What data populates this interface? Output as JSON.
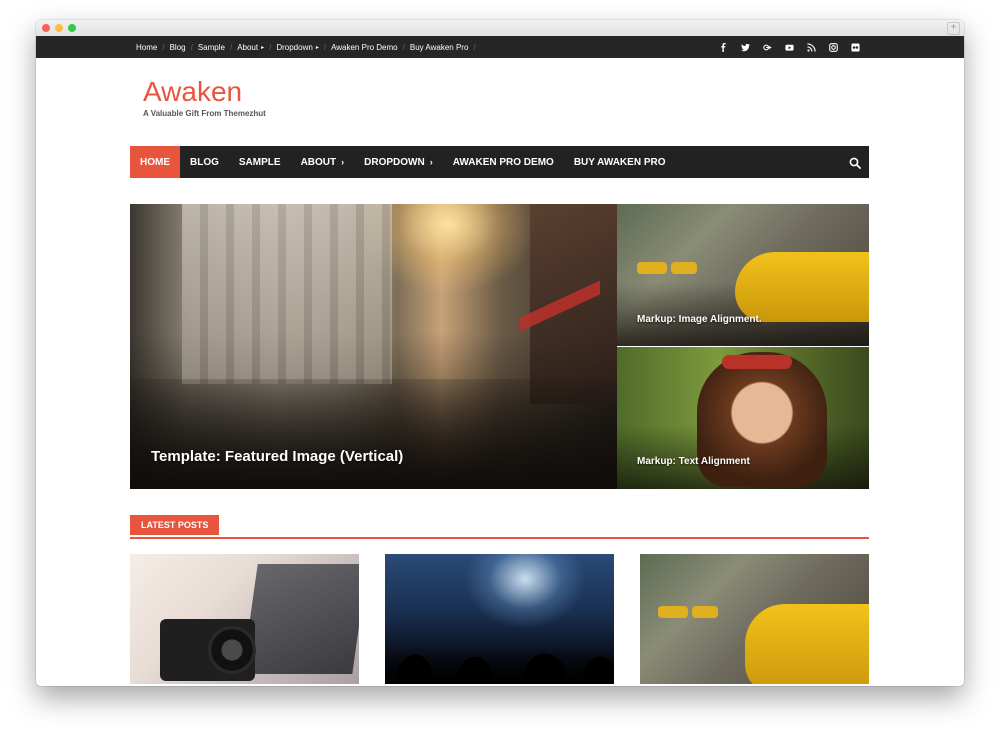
{
  "topbar": {
    "links": [
      {
        "label": "Home"
      },
      {
        "label": "Blog"
      },
      {
        "label": "Sample"
      },
      {
        "label": "About",
        "has_submenu": true
      },
      {
        "label": "Dropdown",
        "has_submenu": true
      },
      {
        "label": "Awaken Pro Demo"
      },
      {
        "label": "Buy Awaken Pro"
      }
    ],
    "social_icons": [
      "facebook-icon",
      "twitter-icon",
      "google-plus-icon",
      "youtube-icon",
      "rss-icon",
      "instagram-icon",
      "flickr-icon"
    ]
  },
  "site": {
    "title": "Awaken",
    "tagline": "A Valuable Gift From Themezhut"
  },
  "nav": {
    "items": [
      {
        "label": "HOME",
        "active": true
      },
      {
        "label": "BLOG"
      },
      {
        "label": "SAMPLE"
      },
      {
        "label": "ABOUT",
        "has_submenu": true
      },
      {
        "label": "DROPDOWN",
        "has_submenu": true
      },
      {
        "label": "AWAKEN PRO DEMO"
      },
      {
        "label": "BUY AWAKEN PRO"
      }
    ],
    "search_icon": "search-icon"
  },
  "featured": {
    "main_title": "Template: Featured Image (Vertical)",
    "side_titles": [
      "Markup: Image Alignment.",
      "Markup: Text Alignment"
    ]
  },
  "latest": {
    "heading": "LATEST POSTS"
  },
  "colors": {
    "accent": "#e8553e",
    "topbar_bg": "#262626",
    "nav_bg": "#222222"
  }
}
